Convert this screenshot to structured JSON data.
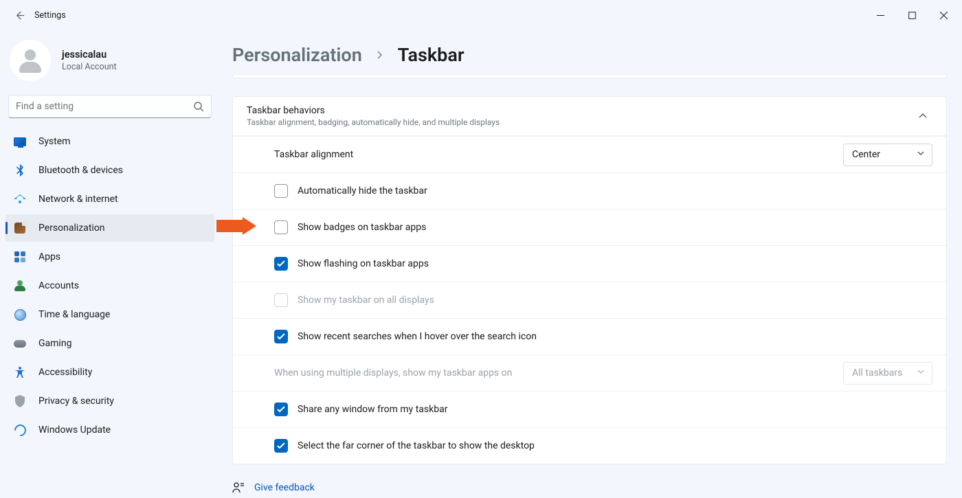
{
  "app": {
    "title": "Settings"
  },
  "user": {
    "name": "jessicalau",
    "account_type": "Local Account"
  },
  "search": {
    "placeholder": "Find a setting"
  },
  "nav": {
    "items": [
      {
        "label": "System"
      },
      {
        "label": "Bluetooth & devices"
      },
      {
        "label": "Network & internet"
      },
      {
        "label": "Personalization"
      },
      {
        "label": "Apps"
      },
      {
        "label": "Accounts"
      },
      {
        "label": "Time & language"
      },
      {
        "label": "Gaming"
      },
      {
        "label": "Accessibility"
      },
      {
        "label": "Privacy & security"
      },
      {
        "label": "Windows Update"
      }
    ],
    "active_index": 3
  },
  "breadcrumb": {
    "parent": "Personalization",
    "current": "Taskbar"
  },
  "panel": {
    "title": "Taskbar behaviors",
    "subtitle": "Taskbar alignment, badging, automatically hide, and multiple displays",
    "alignment_label": "Taskbar alignment",
    "alignment_value": "Center",
    "items": [
      {
        "label": "Automatically hide the taskbar",
        "checked": false,
        "disabled": false
      },
      {
        "label": "Show badges on taskbar apps",
        "checked": false,
        "disabled": false
      },
      {
        "label": "Show flashing on taskbar apps",
        "checked": true,
        "disabled": false
      },
      {
        "label": "Show my taskbar on all displays",
        "checked": false,
        "disabled": true
      },
      {
        "label": "Show recent searches when I hover over the search icon",
        "checked": true,
        "disabled": false
      }
    ],
    "multidisplay_label": "When using multiple displays, show my taskbar apps on",
    "multidisplay_value": "All taskbars",
    "tail_items": [
      {
        "label": "Share any window from my taskbar",
        "checked": true
      },
      {
        "label": "Select the far corner of the taskbar to show the desktop",
        "checked": true
      }
    ]
  },
  "feedback": {
    "label": "Give feedback"
  }
}
